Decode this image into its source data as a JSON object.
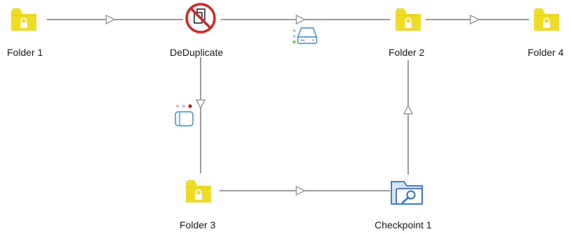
{
  "flow": {
    "nodes": {
      "folder1": {
        "label": "Folder 1",
        "icon": "locked-folder-icon"
      },
      "deduplicate": {
        "label": "DeDuplicate",
        "icon": "deduplicate-icon"
      },
      "folder2": {
        "label": "Folder 2",
        "icon": "locked-folder-icon"
      },
      "folder4": {
        "label": "Folder 4",
        "icon": "locked-folder-icon"
      },
      "folder3": {
        "label": "Folder 3",
        "icon": "locked-folder-icon"
      },
      "checkpoint1": {
        "label": "Checkpoint 1",
        "icon": "checkpoint-search-folder-icon"
      }
    },
    "connection_badges": [
      {
        "connection": "deduplicate-to-folder2",
        "icon": "drive-badge-icon",
        "dots": [
          "#c9c9c9",
          "#c9c9c9",
          "#8cc63f"
        ]
      },
      {
        "connection": "deduplicate-to-folder3",
        "icon": "document-badge-icon",
        "dots": [
          "#c9c9c9",
          "#c9c9c9",
          "#d0021b"
        ]
      }
    ],
    "colors": {
      "folder": "#f0dd1f",
      "connector": "#9b9b9b",
      "forbidden": "#e02020",
      "checkpoint": "#2f6fd6"
    }
  }
}
